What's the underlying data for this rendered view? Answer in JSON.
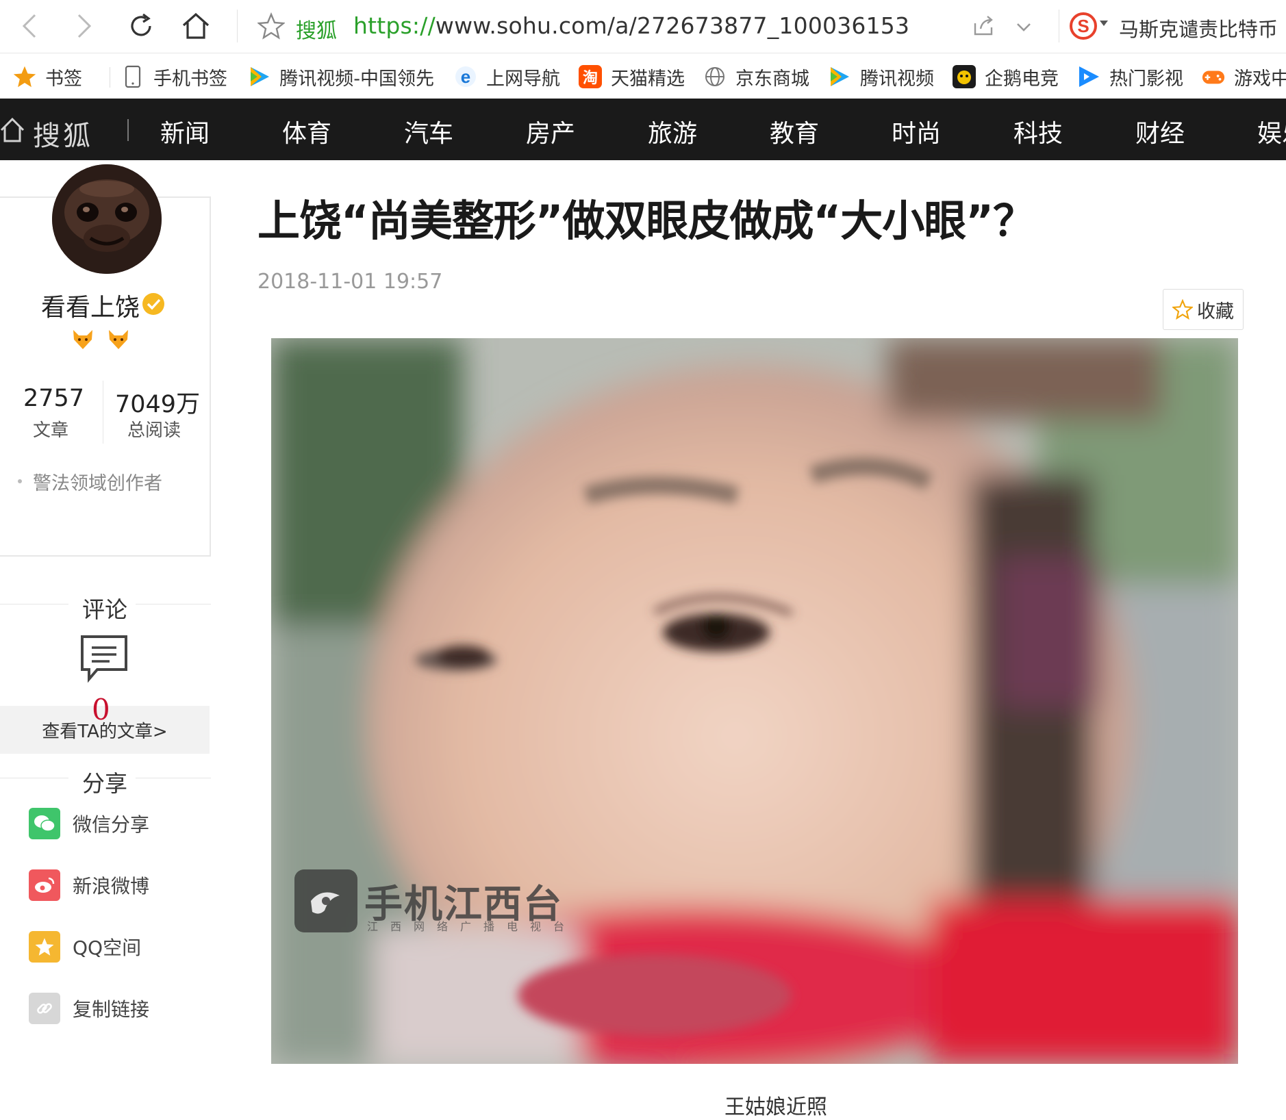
{
  "browser": {
    "site_label": "搜狐",
    "url_proto": "https://",
    "url_rest": "www.sohu.com/a/272673877_100036153",
    "hot_search": "马斯克谴责比特币"
  },
  "bookmarks": [
    {
      "label": "书签",
      "icon": "star-icon"
    },
    {
      "label": "手机书签",
      "icon": "phone-icon"
    },
    {
      "label": "腾讯视频-中国领先",
      "icon": "tencent-video-icon"
    },
    {
      "label": "上网导航",
      "icon": "ie-icon"
    },
    {
      "label": "天猫精选",
      "icon": "taobao-icon"
    },
    {
      "label": "京东商城",
      "icon": "globe-icon"
    },
    {
      "label": "腾讯视频",
      "icon": "tencent-video-icon"
    },
    {
      "label": "企鹅电竞",
      "icon": "penguin-esports-icon"
    },
    {
      "label": "热门影视",
      "icon": "play-icon"
    },
    {
      "label": "游戏中心",
      "icon": "gamepad-icon"
    }
  ],
  "sohu_nav": {
    "logo": "搜狐",
    "items": [
      "新闻",
      "体育",
      "汽车",
      "房产",
      "旅游",
      "教育",
      "时尚",
      "科技",
      "财经",
      "娱乐"
    ]
  },
  "author": {
    "name": "看看上饶",
    "articles_count": "2757",
    "articles_label": "文章",
    "reads_count": "7049万",
    "reads_label": "总阅读",
    "domain_tag": "警法领域创作者",
    "see_articles": "查看TA的文章>"
  },
  "comments": {
    "title": "评论",
    "count": "0"
  },
  "share": {
    "title": "分享",
    "items": [
      {
        "label": "微信分享",
        "color": "#3fc56b"
      },
      {
        "label": "新浪微博",
        "color": "#f0585d"
      },
      {
        "label": "QQ空间",
        "color": "#f5b731"
      },
      {
        "label": "复制链接",
        "color": "#d7d7d7"
      }
    ]
  },
  "article": {
    "title": "上饶“尚美整形”做双眼皮做成“大小眼”？",
    "time": "2018-11-01 19:57",
    "collect_label": "收藏",
    "watermark": "手机江西台",
    "watermark_sub": "江西网络广播电视台",
    "caption": "王姑娘近照"
  },
  "colors": {
    "nav_bg": "#1a1a1a",
    "url_green": "#2aa02a",
    "comment_red": "#c8102e"
  }
}
